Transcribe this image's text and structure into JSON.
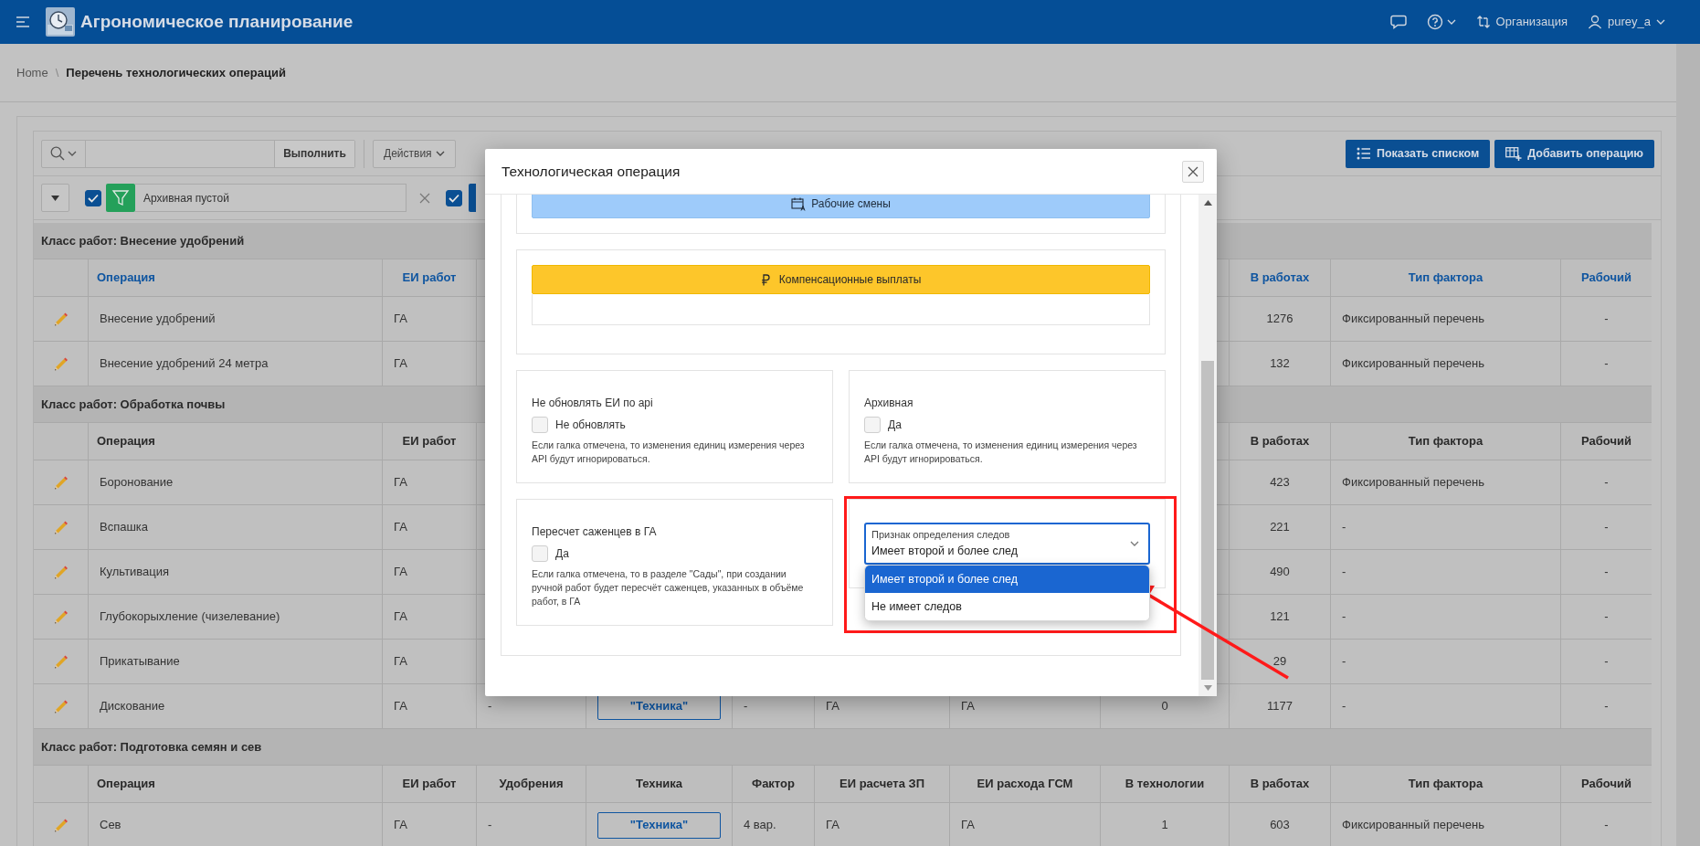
{
  "header": {
    "title": "Агрономическое планирование",
    "actions": [
      {
        "kind": "chat"
      },
      {
        "kind": "help"
      },
      {
        "kind": "org",
        "label": "Организация"
      },
      {
        "kind": "user",
        "label": "purey_a"
      }
    ]
  },
  "breadcrumb": {
    "home": "Home",
    "separator": "\\",
    "current": "Перечень технологических операций"
  },
  "toolbar": {
    "go": "Выполнить",
    "actions": "Действия",
    "buttons": [
      {
        "kind": "list",
        "label": "Показать списком"
      },
      {
        "kind": "add",
        "label": "Добавить операцию"
      }
    ]
  },
  "filters": [
    {
      "checked": true,
      "label": "Архивная пустой"
    },
    {
      "checked": true
    }
  ],
  "table": {
    "groups": [
      {
        "title": "Класс работ: Внесение удобрений",
        "header_links": true,
        "columns": {
          "operation": "Операция",
          "unit": "ЕИ работ",
          "in_works": "В работах",
          "factor_type": "Тип фактора",
          "worker": "Рабочий"
        },
        "rows": [
          {
            "cells": {
              "operation": "Внесение удобрений",
              "unit": "ГА",
              "in_works": "1276",
              "factor_type": "Фиксированный перечень",
              "worker": "-"
            }
          },
          {
            "cells": {
              "operation": "Внесение удобрений 24 метра",
              "unit": "ГА",
              "in_works": "132",
              "factor_type": "Фиксированный перечень",
              "worker": "-"
            }
          }
        ]
      },
      {
        "title": "Класс работ: Обработка почвы",
        "header_links": false,
        "columns": {
          "operation": "Операция",
          "unit": "ЕИ работ",
          "in_works": "В работах",
          "factor_type": "Тип фактора",
          "worker": "Рабочий"
        },
        "rows": [
          {
            "cells": {
              "operation": "Боронование",
              "unit": "ГА",
              "in_works": "423",
              "factor_type": "Фиксированный перечень",
              "worker": "-"
            }
          },
          {
            "cells": {
              "operation": "Вспашка",
              "unit": "ГА",
              "in_works": "221",
              "factor_type": "-",
              "worker": "-"
            }
          },
          {
            "cells": {
              "operation": "Культивация",
              "unit": "ГА",
              "in_works": "490",
              "factor_type": "-",
              "worker": "-"
            }
          },
          {
            "cells": {
              "operation": "Глубокорыхление (чизелевание)",
              "unit": "ГА",
              "in_works": "121",
              "factor_type": "-",
              "worker": "-"
            }
          },
          {
            "cells": {
              "operation": "Прикатывание",
              "unit": "ГА",
              "in_works": "29",
              "factor_type": "-",
              "worker": "-"
            }
          },
          {
            "cells": {
              "operation": "Дискование",
              "unit": "ГА",
              "fertilizers": "-",
              "equipment": "\"Техника\"",
              "factor": "-",
              "wage_unit": "ГА",
              "fuel_unit": "ГА",
              "in_technology": "0",
              "in_works": "1177",
              "factor_type": "-",
              "worker": "-"
            }
          }
        ]
      },
      {
        "title": "Класс работ: Подготовка семян и сев",
        "header_links": false,
        "columns": {
          "operation": "Операция",
          "unit": "ЕИ работ",
          "fertilizers": "Удобрения",
          "equipment": "Техника",
          "factor": "Фактор",
          "wage_unit": "ЕИ расчета ЗП",
          "fuel_unit": "ЕИ расхода ГСМ",
          "in_technology": "В технологии",
          "in_works": "В работах",
          "factor_type": "Тип фактора",
          "worker": "Рабочий"
        },
        "rows": [
          {
            "cells": {
              "operation": "Сев",
              "unit": "ГА",
              "fertilizers": "-",
              "equipment": "\"Техника\"",
              "factor": "4 вар.",
              "wage_unit": "ГА",
              "fuel_unit": "ГА",
              "in_technology": "1",
              "in_works": "603",
              "factor_type": "Фиксированный перечень",
              "worker": "-"
            }
          }
        ]
      }
    ]
  },
  "modal": {
    "title": "Технологическая операция",
    "sections": [
      {
        "kind": "shifts",
        "label": "Рабочие смены"
      },
      {
        "kind": "compensation",
        "label": "Компенсационные выплаты"
      }
    ],
    "cards": [
      {
        "kind": "checkbox",
        "label": "Не обновлять ЕИ по api",
        "option": "Не обновлять",
        "checked": false,
        "help": "Если галка отмечена, то изменения единиц измерения через API будут игнорироваться."
      },
      {
        "kind": "checkbox",
        "label": "Архивная",
        "option": "Да",
        "checked": false,
        "help": "Если галка отмечена, то изменения единиц измерения через API будут игнорироваться."
      },
      {
        "kind": "checkbox",
        "label": "Пересчет саженцев в ГА",
        "option": "Да",
        "checked": false,
        "help": "Если галка отмечена, то в разделе \"Сады\", при создании ручной работ будет пересчёт саженцев, указанных в объёме работ, в ГА"
      },
      {
        "kind": "select",
        "label": "Признак определения следов",
        "value": "Имеет второй и более след",
        "expanded": true,
        "options": [
          {
            "label": "Имеет второй и более след",
            "selected": true
          },
          {
            "label": "Не имеет следов",
            "selected": false
          }
        ]
      }
    ]
  }
}
